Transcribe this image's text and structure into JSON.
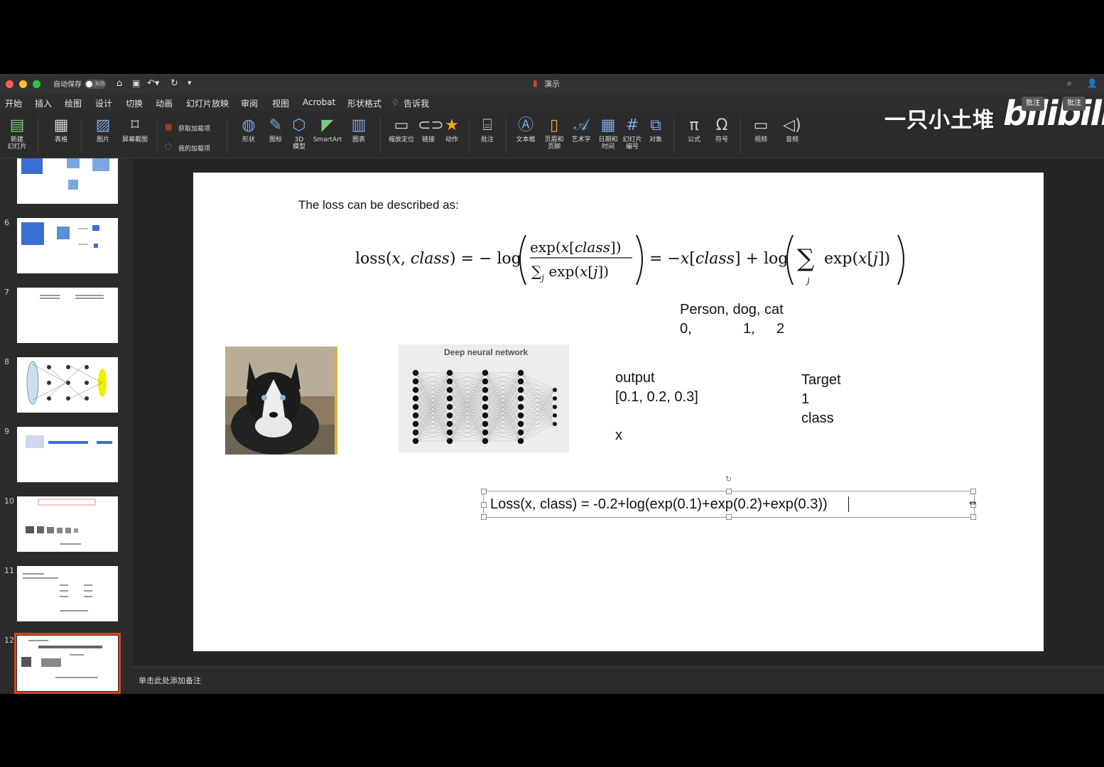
{
  "titlebar": {
    "autosave_label": "自动保存",
    "autosave_state": "关闭",
    "doc_title": "演示",
    "colors": {
      "close": "#ff5f57",
      "min": "#febc2e",
      "max": "#28c840"
    }
  },
  "tabs": [
    "开始",
    "插入",
    "绘图",
    "设计",
    "切换",
    "动画",
    "幻灯片放映",
    "审阅",
    "视图",
    "Acrobat",
    "形状格式",
    "告诉我"
  ],
  "ribbon": {
    "new_slide": "新建\n幻灯片",
    "table": "表格",
    "picture": "图片",
    "screenshot": "屏幕截图",
    "get_addins": "获取加载项",
    "my_addins": "我的加载项",
    "shapes": "形状",
    "icons": "图标",
    "model3d": "3D\n模型",
    "smartart": "SmartArt",
    "chart": "图表",
    "zoom": "缩放定位",
    "link": "链接",
    "action": "动作",
    "comment": "批注",
    "textbox": "文本框",
    "header_footer": "页眉和\n页脚",
    "wordart": "艺术字",
    "datetime": "日期和\n时间",
    "slide_number": "幻灯片\n编号",
    "object": "对象",
    "equation": "公式",
    "symbol": "符号",
    "video": "视频",
    "audio": "音频"
  },
  "watermark": {
    "text": "一只小土堆",
    "logo": "bilibili",
    "btn1": "批注",
    "btn2": "批注"
  },
  "thumbnails": [
    {
      "num": "",
      "top": 0
    },
    {
      "num": "6"
    },
    {
      "num": "7"
    },
    {
      "num": "8"
    },
    {
      "num": "9"
    },
    {
      "num": "10"
    },
    {
      "num": "11"
    },
    {
      "num": "12",
      "selected": true
    }
  ],
  "slide": {
    "intro": "The loss can be described as:",
    "classes_line1": "Person, dog, cat",
    "classes_line2_a": "0,",
    "classes_line2_b": "1,",
    "classes_line2_c": "2",
    "dnn_title": "Deep neural network",
    "output_label": "output",
    "output_values": "[0.1, 0.2, 0.3]",
    "x_label": "x",
    "target_label": "Target",
    "target_value": "1",
    "class_label": "class",
    "loss_text": "Loss(x, class)  =  -0.2+log(exp(0.1)+exp(0.2)+exp(0.3))"
  },
  "notes_placeholder": "单击此处添加备注"
}
